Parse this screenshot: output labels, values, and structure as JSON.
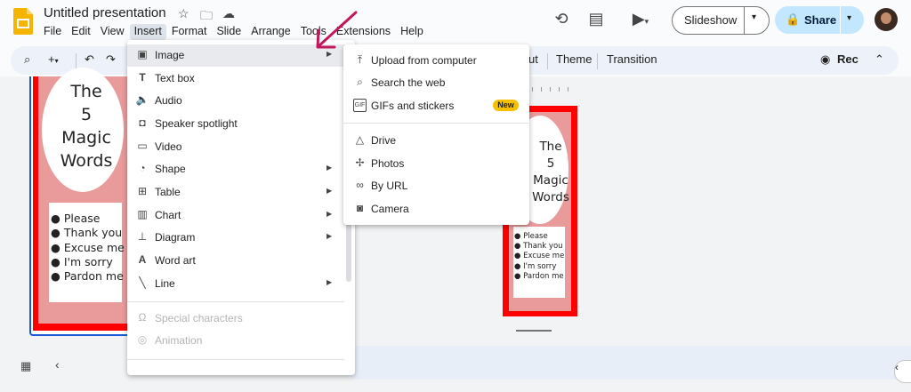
{
  "app": {
    "doc_title": "Untitled presentation",
    "menu_bar": [
      "File",
      "Edit",
      "View",
      "Insert",
      "Format",
      "Slide",
      "Arrange",
      "Tools",
      "Extensions",
      "Help"
    ],
    "active_menu": "Insert",
    "slideshow_label": "Slideshow",
    "share_label": "Share"
  },
  "toolbar": {
    "partial_label": "ut",
    "theme_label": "Theme",
    "transition_label": "Transition",
    "rec_label": "Rec"
  },
  "slide": {
    "title_lines": [
      "The",
      "5",
      "Magic",
      "Words"
    ],
    "bullets": [
      "Please",
      "Thank you",
      "Excuse me",
      "I'm sorry",
      "Pardon me"
    ]
  },
  "insert_menu": {
    "items": [
      {
        "label": "Image",
        "icon": "image-icon",
        "submenu": true,
        "highlighted": true
      },
      {
        "label": "Text box",
        "icon": "text-box-icon"
      },
      {
        "label": "Audio",
        "icon": "audio-icon"
      },
      {
        "label": "Speaker spotlight",
        "icon": "speaker-spotlight-icon"
      },
      {
        "label": "Video",
        "icon": "video-icon"
      },
      {
        "label": "Shape",
        "icon": "shape-icon",
        "submenu": true
      },
      {
        "label": "Table",
        "icon": "table-icon",
        "submenu": true
      },
      {
        "label": "Chart",
        "icon": "chart-icon",
        "submenu": true
      },
      {
        "label": "Diagram",
        "icon": "diagram-icon",
        "submenu": true
      },
      {
        "label": "Word art",
        "icon": "word-art-icon"
      },
      {
        "label": "Line",
        "icon": "line-icon",
        "submenu": true
      },
      {
        "label": "Special characters",
        "icon": "omega-icon",
        "disabled": true
      },
      {
        "label": "Animation",
        "icon": "animation-icon",
        "disabled": true
      }
    ]
  },
  "image_submenu": {
    "items": [
      {
        "label": "Upload from computer",
        "icon": "upload-icon"
      },
      {
        "label": "Search the web",
        "icon": "search-icon"
      },
      {
        "label": "GIFs and stickers",
        "icon": "gif-icon",
        "badge": "New"
      },
      {
        "label": "Drive",
        "icon": "drive-icon"
      },
      {
        "label": "Photos",
        "icon": "photos-icon"
      },
      {
        "label": "By URL",
        "icon": "link-icon"
      },
      {
        "label": "Camera",
        "icon": "camera-icon"
      }
    ]
  },
  "colors": {
    "share_bg": "#c2e7ff",
    "menu_highlight": "#e8eaed",
    "new_badge": "#f6c000",
    "slide_border": "#ff0000",
    "slide_fill": "#e99a9a",
    "annotation_arrow": "#c2185b"
  }
}
